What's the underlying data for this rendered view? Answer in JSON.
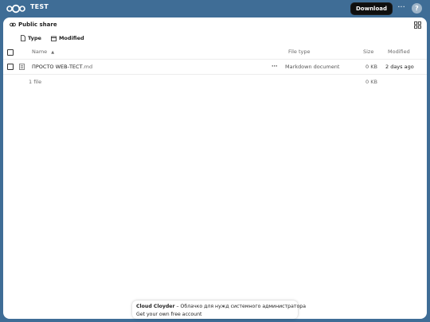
{
  "header": {
    "title": "TEST",
    "logo_icon": "nextcloud-logo-icon",
    "download_label": "Download",
    "more_label": "···",
    "help_label": "?"
  },
  "share": {
    "title": "Public share",
    "link_icon": "link-icon",
    "grid_icon": "grid-view-icon"
  },
  "filters": [
    {
      "label": "Type",
      "icon": "file-icon"
    },
    {
      "label": "Modified",
      "icon": "calendar-icon"
    }
  ],
  "table": {
    "columns": {
      "name": "Name",
      "file_type": "File type",
      "size": "Size",
      "modified": "Modified"
    },
    "sort_indicator": "▲",
    "rows": [
      {
        "name": "ПРОСТО WEB-ТЕСТ",
        "ext": ".md",
        "actions": "···",
        "file_type": "Markdown document",
        "size": "0 KB",
        "modified": "2 days ago",
        "icon": "text-document-icon"
      }
    ],
    "summary": {
      "count": "1 file",
      "size": "0 KB"
    }
  },
  "footer": {
    "brand": "Cloud Cloyder",
    "tagline": " – Облачко для нужд системного администратора",
    "signup": "Get your own free account"
  },
  "colors": {
    "header_bg": "#3f6d96",
    "panel_bg": "#ffffff",
    "button_dark": "#0f0f0f"
  }
}
